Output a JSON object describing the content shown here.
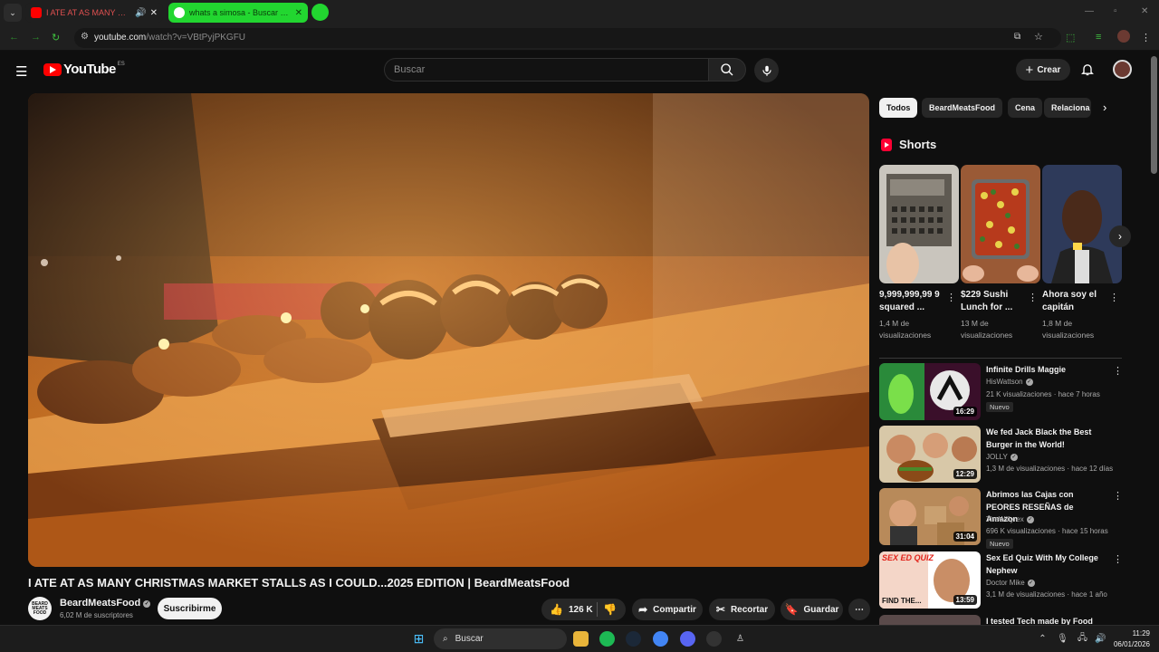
{
  "browser": {
    "tabs": [
      {
        "title": "I ATE AT AS MANY CHRISTM",
        "active": false,
        "close": "✕"
      },
      {
        "title": "whats a simosa - Buscar con G",
        "active": true,
        "close": "✕"
      }
    ],
    "url_host": "youtube.com",
    "url_path": "/watch?v=VBtPyjPKGFU"
  },
  "youtube": {
    "logo_text": "YouTube",
    "country_code": "ES",
    "search_placeholder": "Buscar",
    "create_label": "Crear"
  },
  "video": {
    "title": "I ATE AT AS MANY CHRISTMAS MARKET STALLS AS I COULD...2025 EDITION | BeardMeatsFood",
    "channel": "BeardMeatsFood",
    "channel_avatar_text": "BEARD MEATS FOOD",
    "subscribers": "6,02 M de suscriptores",
    "subscribe_label": "Suscribirme",
    "likes": "126 K",
    "share_label": "Compartir",
    "clip_label": "Recortar",
    "save_label": "Guardar"
  },
  "chips": [
    "Todos",
    "BeardMeatsFood",
    "Cena",
    "Relaciona"
  ],
  "shorts": {
    "heading": "Shorts",
    "items": [
      {
        "title": "9,999,999,99 9 squared ...",
        "views": "1,4 M de visualizaciones"
      },
      {
        "title": "$229 Sushi Lunch for ...",
        "views": "13 M de visualizaciones"
      },
      {
        "title": "Ahora soy el capitán",
        "views": "1,8 M de visualizaciones"
      }
    ]
  },
  "recommendations": [
    {
      "title": "Infinite Drills Maggie",
      "channel": "HisWattson",
      "meta": "21 K visualizaciones · hace 7 horas",
      "duration": "16:29",
      "badge": "Nuevo"
    },
    {
      "title": "We fed Jack Black the Best Burger in the World!",
      "channel": "JOLLY",
      "meta": "1,3 M de visualizaciones · hace 12 días",
      "duration": "12:29",
      "badge": ""
    },
    {
      "title": "Abrimos las Cajas con PEORES RESEÑAS de Amazon",
      "channel": "TheWillyrex",
      "meta": "696 K visualizaciones · hace 15 horas",
      "duration": "31:04",
      "badge": "Nuevo"
    },
    {
      "title": "Sex Ed Quiz With My College Nephew",
      "channel": "Doctor Mike",
      "meta": "3,1 M de visualizaciones · hace 1 año",
      "duration": "13:59",
      "badge": ""
    },
    {
      "title": "I tested Tech made by Food",
      "channel": "",
      "meta": "",
      "duration": "",
      "badge": ""
    }
  ],
  "thumb_text": {
    "sexed_top": "SEX ED QUIZ",
    "sexed_bottom": "FIND THE..."
  },
  "taskbar": {
    "search_label": "Buscar",
    "time": "11:29",
    "date": "06/01/2026"
  }
}
